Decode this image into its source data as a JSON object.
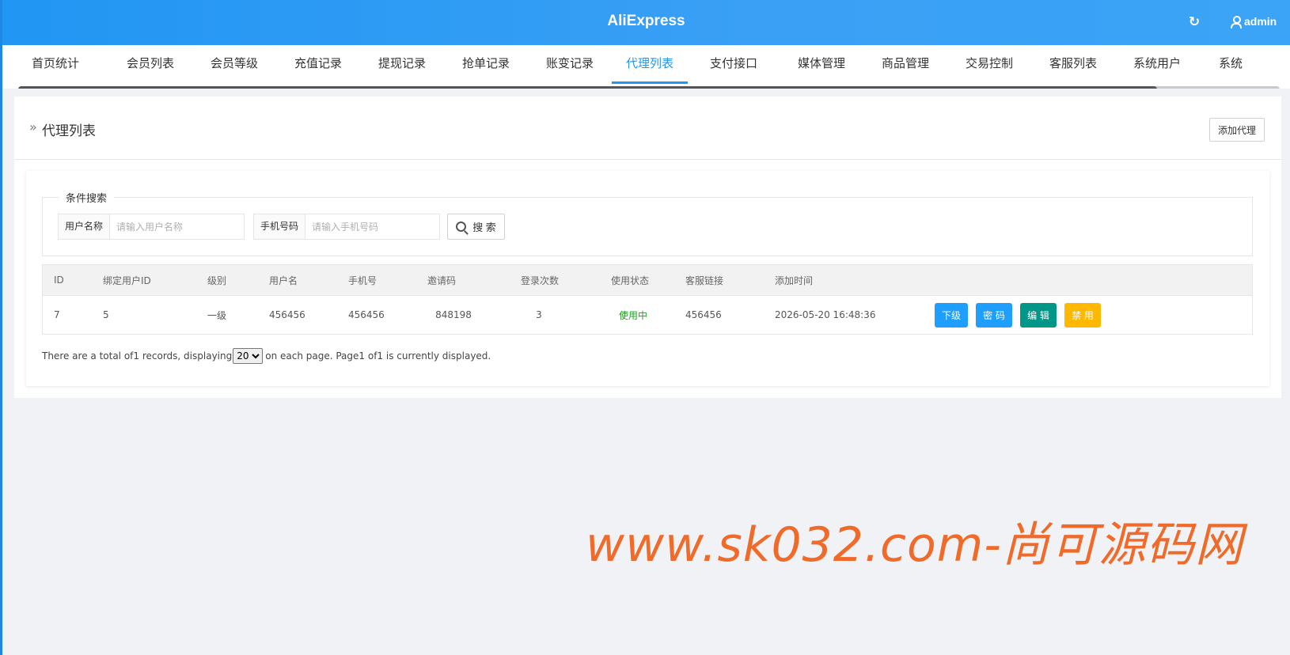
{
  "header": {
    "app_title": "AliExpress",
    "refresh_icon": "refresh-icon",
    "user_icon": "user-icon",
    "user_name": "admin"
  },
  "nav": {
    "tabs": [
      {
        "label": "首页统计",
        "active": false
      },
      {
        "label": "会员列表",
        "active": false
      },
      {
        "label": "会员等级",
        "active": false
      },
      {
        "label": "充值记录",
        "active": false
      },
      {
        "label": "提现记录",
        "active": false
      },
      {
        "label": "抢单记录",
        "active": false
      },
      {
        "label": "账变记录",
        "active": false
      },
      {
        "label": "代理列表",
        "active": true
      },
      {
        "label": "支付接口",
        "active": false
      },
      {
        "label": "媒体管理",
        "active": false
      },
      {
        "label": "商品管理",
        "active": false
      },
      {
        "label": "交易控制",
        "active": false
      },
      {
        "label": "客服列表",
        "active": false
      },
      {
        "label": "系统用户",
        "active": false
      },
      {
        "label": "系统",
        "active": false
      }
    ],
    "accent_color": "#2196f3"
  },
  "page": {
    "title": "代理列表",
    "breadcrumb_icon": "double-chevron-right-icon",
    "add_button": "添加代理"
  },
  "search": {
    "legend": "条件搜索",
    "username_label": "用户名称",
    "username_placeholder": "请输入用户名称",
    "username_value": "",
    "phone_label": "手机号码",
    "phone_placeholder": "请输入手机号码",
    "phone_value": "",
    "button": "搜 索"
  },
  "table": {
    "headers": [
      "ID",
      "绑定用户ID",
      "级别",
      "用户名",
      "手机号",
      "邀请码",
      "登录次数",
      "使用状态",
      "客服链接",
      "添加时间"
    ],
    "rows": [
      {
        "cells": [
          "7",
          "5",
          "一级",
          "456456",
          "456456",
          "848198",
          "3",
          "使用中",
          "456456",
          "2026-05-20 16:48:36"
        ],
        "actions": [
          "下级",
          "密 码",
          "编 辑",
          "禁 用"
        ]
      }
    ]
  },
  "pagination": {
    "prefix": "There are a total of1 records, displaying",
    "per_page": "20",
    "suffix": "on each page. Page1 of1 is currently displayed."
  },
  "watermark": "www.sk032.com-尚可源码网"
}
